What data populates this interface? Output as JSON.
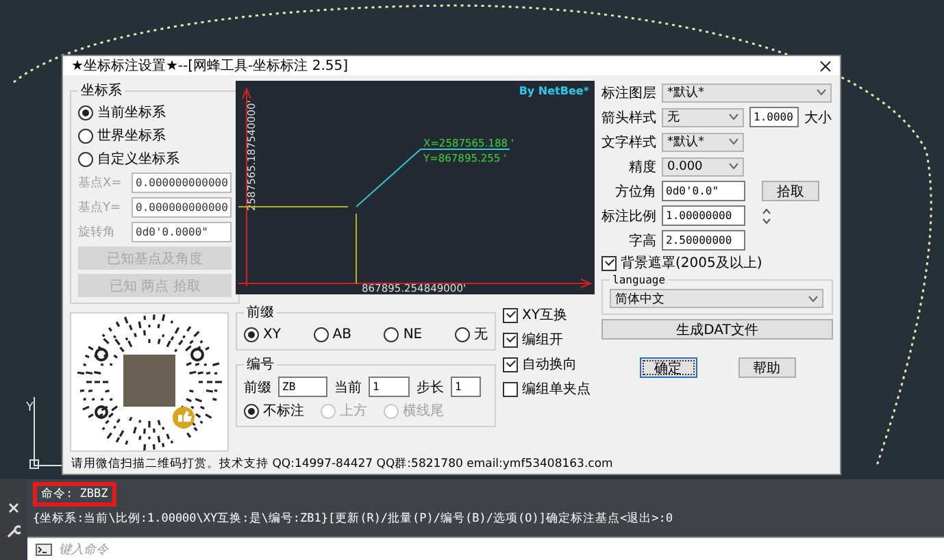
{
  "window": {
    "title": "★坐标标注设置★--[网蜂工具-坐标标注 2.55]"
  },
  "ucs_label": "Y",
  "coordinate_system": {
    "title": "坐标系",
    "options": [
      {
        "label": "当前坐标系",
        "selected": true
      },
      {
        "label": "世界坐标系",
        "selected": false
      },
      {
        "label": "自定义坐标系",
        "selected": false
      }
    ],
    "fields": [
      {
        "label": "基点X=",
        "value": "0.000000000000",
        "disabled": true
      },
      {
        "label": "基点Y=",
        "value": "0.000000000000",
        "disabled": true
      },
      {
        "label": "旋转角",
        "value": "0d0'0.0000\"",
        "disabled": true
      }
    ],
    "buttons": [
      {
        "label": "已知基点及角度",
        "disabled": true
      },
      {
        "label": "已知 两点 拾取",
        "disabled": true
      }
    ]
  },
  "preview": {
    "brand": "By NetBee*",
    "y_axis_label": "2587565.187540000'",
    "x_axis_label": "867895.254849000'",
    "point_x": "X=2587565.188 '",
    "point_y": "Y=867895.255 '"
  },
  "prefix": {
    "title": "前缀",
    "options": [
      {
        "label": "XY",
        "selected": true
      },
      {
        "label": "AB",
        "selected": false
      },
      {
        "label": "NE",
        "selected": false
      },
      {
        "label": "无",
        "selected": false
      }
    ]
  },
  "numbering": {
    "title": "编号",
    "fields": [
      {
        "label": "前缀",
        "value": "ZB"
      },
      {
        "label": "当前",
        "value": "1"
      },
      {
        "label": "步长",
        "value": "1"
      }
    ],
    "options": [
      {
        "label": "不标注",
        "selected": true,
        "disabled": false
      },
      {
        "label": "上方",
        "selected": false,
        "disabled": true
      },
      {
        "label": "横线尾",
        "selected": false,
        "disabled": true
      }
    ]
  },
  "options": [
    {
      "label": "XY互换",
      "checked": true
    },
    {
      "label": "编组开",
      "checked": true
    },
    {
      "label": "自动换向",
      "checked": true
    },
    {
      "label": "编组单夹点",
      "checked": false
    }
  ],
  "settings": [
    {
      "kind": "select",
      "label": "标注图层",
      "value": "*默认*"
    },
    {
      "kind": "select_size",
      "label": "箭头样式",
      "value": "无",
      "size_value": "1.0000",
      "size_label": "大小"
    },
    {
      "kind": "select",
      "label": "文字样式",
      "value": "*默认*"
    },
    {
      "kind": "select",
      "label": "精度",
      "value": "0.000"
    },
    {
      "kind": "pick",
      "label": "方位角",
      "value": "0d0'0.0\"",
      "button": "拾取"
    },
    {
      "kind": "spin",
      "label": "标注比例",
      "value": "1.00000000"
    },
    {
      "kind": "text",
      "label": "字高",
      "value": "2.50000000"
    }
  ],
  "background_mask": {
    "label": "背景遮罩(2005及以上)",
    "checked": true
  },
  "language": {
    "title": "language",
    "value": "简体中文"
  },
  "generate_button": "生成DAT文件",
  "buttons": [
    {
      "label": "确定",
      "default": true
    },
    {
      "label": "帮助",
      "default": false
    }
  ],
  "footer": "请用微信扫描二维码打赏。技术支持 QQ:14997-84427 QQ群:5821780 email:ymf53408163.com",
  "command_line": {
    "command": "命令: ZBBZ",
    "prompt": "{坐标系:当前\\比例:1.00000\\XY互换:是\\编号:ZB1}[更新(R)/批量(P)/编号(B)/选项(O)]确定标注基点<退出>:0",
    "placeholder": "键入命令"
  }
}
